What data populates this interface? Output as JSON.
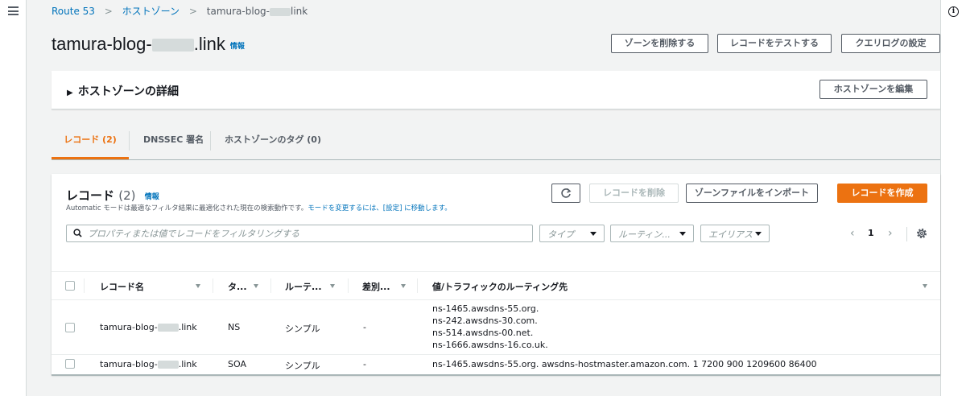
{
  "breadcrumb": {
    "root": "Route 53",
    "zones": "ホストゾーン",
    "current_prefix": "tamura-blog-",
    "current_suffix": "link"
  },
  "page": {
    "title_prefix": "tamura-blog-",
    "title_suffix": ".link",
    "info": "情報"
  },
  "header_buttons": {
    "delete_zone": "ゾーンを削除する",
    "test_record": "レコードをテストする",
    "query_logging": "クエリログの設定"
  },
  "details": {
    "title": "ホストゾーンの詳細",
    "edit": "ホストゾーンを編集"
  },
  "tabs": [
    {
      "label": "レコード (2)"
    },
    {
      "label": "DNSSEC 署名"
    },
    {
      "label": "ホストゾーンのタグ (0)"
    }
  ],
  "records": {
    "title": "レコード",
    "count": "(2)",
    "info": "情報",
    "desc": "Automatic モードは最適なフィルタ結果に最適化された現在の検索動作です。",
    "desc_link": "モードを変更するには、[設定] に移動します。",
    "delete": "レコードを削除",
    "import": "ゾーンファイルをインポート",
    "create": "レコードを作成",
    "search_placeholder": "プロパティまたは値でレコードをフィルタリングする",
    "filters": {
      "type": "タイプ",
      "routing": "ルーティン...",
      "alias": "エイリアス"
    },
    "page": "1",
    "prev": "‹",
    "next": "›",
    "columns": {
      "name": "レコード名",
      "type": "タ...",
      "routing": "ルーテ...",
      "diff": "差別...",
      "value": "値/トラフィックのルーティング先"
    },
    "rows": [
      {
        "name_prefix": "tamura-blog-",
        "name_suffix": ".link",
        "type": "NS",
        "routing": "シンプル",
        "diff": "-",
        "values": [
          "ns-1465.awsdns-55.org.",
          "ns-242.awsdns-30.com.",
          "ns-514.awsdns-00.net.",
          "ns-1666.awsdns-16.co.uk."
        ]
      },
      {
        "name_prefix": "tamura-blog-",
        "name_suffix": ".link",
        "type": "SOA",
        "routing": "シンプル",
        "diff": "-",
        "value": "ns-1465.awsdns-55.org. awsdns-hostmaster.amazon.com. 1 7200 900 1209600 86400"
      }
    ]
  },
  "colors": {
    "accent": "#ec7211",
    "link": "#0073bb",
    "text": "#16191f",
    "muted": "#545b64",
    "background": "#f2f3f3"
  },
  "icons": {
    "menu": "hamburger-icon",
    "info": "info-icon",
    "refresh": "refresh-icon",
    "search": "search-icon",
    "settings": "gear-icon"
  }
}
